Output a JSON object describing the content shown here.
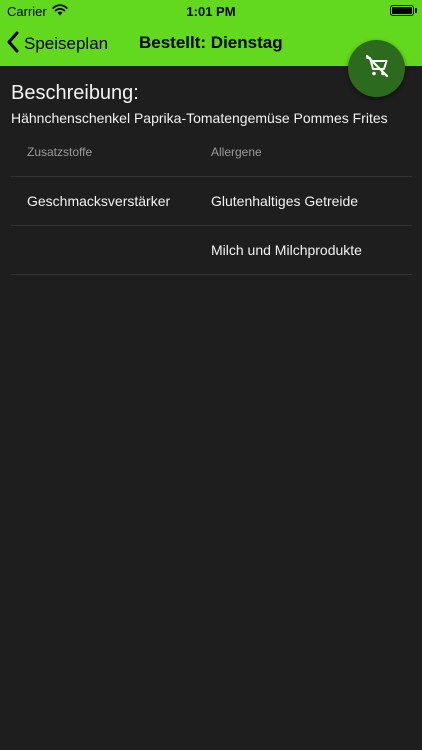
{
  "status_bar": {
    "carrier": "Carrier",
    "time": "1:01 PM"
  },
  "nav": {
    "back_label": "Speiseplan",
    "title": "Bestellt: Dienstag"
  },
  "fab": {
    "icon": "remove-from-cart-icon"
  },
  "description": {
    "heading": "Beschreibung:",
    "text": "Hähnchenschenkel Paprika-Tomatengemüse Pommes Frites"
  },
  "table": {
    "columns": [
      "Zusatzstoffe",
      "Allergene"
    ],
    "rows": [
      [
        "Geschmacksverstärker",
        "Glutenhaltiges Getreide"
      ],
      [
        "",
        "Milch und Milchprodukte"
      ]
    ]
  },
  "colors": {
    "accent": "#62d81e",
    "fab": "#2c6a1e",
    "background": "#1e1e1e",
    "text": "#f2f2f2",
    "muted_text": "#9a9a9a"
  }
}
